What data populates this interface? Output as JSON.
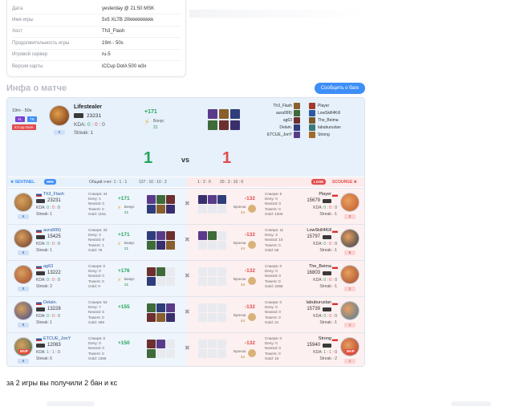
{
  "info": {
    "rows": [
      {
        "key": "Дата",
        "value": "yesterday @ 21:50 MSK"
      },
      {
        "key": "Имя игры",
        "value": "5x5 XLTB 20kkkkkkkkkk"
      },
      {
        "key": "Хост",
        "value": "Th3_Flash"
      },
      {
        "key": "Продолжительность игры",
        "value": "19m - 50s"
      },
      {
        "key": "Игровой сервер",
        "value": "ru-5"
      },
      {
        "key": "Версия карты",
        "value": "iCCup DotA 500 w3x"
      }
    ]
  },
  "section_title": "Инфа о матче",
  "report_button": "Сообщить о баге",
  "banner": {
    "duration": "19m - 50s",
    "tags": [
      "XL",
      "TB"
    ],
    "mode": "iCCup DotA",
    "mvp": {
      "hero": "Lifestealer",
      "mmr": "23231",
      "kda_label": "KDA:",
      "kda": [
        "0",
        "0",
        "0"
      ],
      "streak": "Streak: 1",
      "level": "6"
    },
    "gain": "+171",
    "bonus_label": "Бонус",
    "bonus_value": "21",
    "score_left": "1",
    "vs": "vs",
    "score_right": "1",
    "right_list": [
      "Th3_Flash",
      "aura999)",
      "ag63",
      "Delain.",
      "ETCUE_JonY"
    ],
    "right_list2": [
      "Player",
      "LowSkill4Kill",
      "The_Beima",
      "labuburuslan",
      "Strong"
    ]
  },
  "team_header": {
    "left_label": "SENTINEL",
    "left_result": "WIN",
    "total_label": "Общий счет: 1 : 1 : 1",
    "left_totals": "127 : 10 : 10 : 2",
    "mid_totals": "1 : 2 : 0",
    "right_totals": "20 : 3 : 10 : 0",
    "right_result": "LOSE",
    "right_label": "SCOURGE"
  },
  "rows": [
    {
      "left": {
        "name": "Th3_Flash",
        "mmr": "23231",
        "kda": [
          "0",
          "0",
          "0"
        ],
        "streak": "Streak: 1",
        "level": "6",
        "mvp": false,
        "stats": [
          "Спаерв: 44",
          "Deny: 1",
          "Neutral: 0",
          "Towers: 0",
          "Gold: 1161"
        ],
        "gain": "+171",
        "bonus": "21"
      },
      "right": {
        "name": "Player",
        "mmr": "15679",
        "kda": [
          "0",
          "0",
          "0"
        ],
        "streak": "Streak: -1",
        "level": "3",
        "mvp": false,
        "stats": [
          "Спаерв: 6",
          "Deny: 0",
          "Neutral: 0",
          "Towers: 0",
          "Gold: 1000"
        ],
        "loss": "-132",
        "bronze": "Бронза",
        "bronze_val": "44"
      }
    },
    {
      "left": {
        "name": "aura999)",
        "mmr": "15425",
        "kda": [
          "0",
          "0",
          "0"
        ],
        "streak": "Streak: 1",
        "level": "8",
        "mvp": false,
        "stats": [
          "Спаерв: 33",
          "Deny: 2",
          "Neutral: 8",
          "Towers: 1",
          "Gold: 75"
        ],
        "gain": "+171",
        "bonus": "21"
      },
      "right": {
        "name": "LowSkill4Kill",
        "mmr": "15797",
        "kda": [
          "0",
          "0",
          "0"
        ],
        "streak": "Streak: -1",
        "level": "5",
        "mvp": false,
        "stats": [
          "Спаерв: 11",
          "Deny: 3",
          "Neutral: 10",
          "Towers: 0",
          "Gold: 56"
        ],
        "loss": "-132",
        "bronze": "Бронза",
        "bronze_val": "44"
      }
    },
    {
      "left": {
        "name": "ag63",
        "mmr": "13222",
        "kda": [
          "0",
          "0",
          "0"
        ],
        "streak": "Streak: 2",
        "level": "8",
        "mvp": false,
        "stats": [
          "Спаерв: 0",
          "Deny: 0",
          "Neutral: 0",
          "Towers: 0",
          "Gold: 0"
        ],
        "gain": "+176",
        "bonus": "21"
      },
      "right": {
        "name": "The_Beima",
        "mmr": "16803",
        "kda": [
          "0",
          "0",
          "0"
        ],
        "streak": "Streak: -1",
        "level": "1",
        "mvp": false,
        "stats": [
          "Спаерв: 0",
          "Deny: 0",
          "Neutral: 0",
          "Towers: 0",
          "Gold: 2255"
        ],
        "loss": "-132",
        "bronze": "Бронза",
        "bronze_val": "44"
      }
    },
    {
      "left": {
        "name": "Delain.",
        "mmr": "13228",
        "kda": [
          "0",
          "0",
          "0"
        ],
        "streak": "Streak: 1",
        "level": "8",
        "mvp": false,
        "stats": [
          "Спаерв: 53",
          "Deny: 7",
          "Neutral: 5",
          "Towers: 0",
          "Gold: 469"
        ],
        "gain": "+155",
        "bonus": ""
      },
      "right": {
        "name": "labuburuslan",
        "mmr": "15739",
        "kda": [
          "0",
          "0",
          "0"
        ],
        "streak": "Streak: -1",
        "level": "1",
        "mvp": false,
        "stats": [
          "Спаерв: 0",
          "Deny: 0",
          "Neutral: 0",
          "Towers: 0",
          "Gold: 21"
        ],
        "loss": "-132",
        "bronze": "Бронза",
        "bronze_val": "44"
      }
    },
    {
      "left": {
        "name": "ETCUE_JonY",
        "mmr": "12083",
        "kda": [
          "1",
          "1",
          "0"
        ],
        "streak": "Streak: 6",
        "level": "8",
        "mvp": true,
        "stats": [
          "Спаерв: 0",
          "Deny: 0",
          "Neutral: 0",
          "Towers: 0",
          "Gold: 1365"
        ],
        "gain": "+150",
        "bonus": ""
      },
      "right": {
        "name": "Strong",
        "mmr": "15940",
        "kda": [
          "1",
          "1",
          "0"
        ],
        "streak": "Streak: -2",
        "level": "1",
        "mvp": true,
        "stats": [
          "Спаерв: 0",
          "Deny: 0",
          "Neutral: 0",
          "Towers: 0",
          "Gold: 19"
        ],
        "loss": "-132",
        "bronze": "Бронза",
        "bronze_val": "44"
      }
    }
  ],
  "mvp_label": "MVP",
  "kda_label": "KDA:",
  "footer_text": "за 2 игры вы получили 2 бан и кс",
  "colors": {
    "accent": "#3e8ef7",
    "win": "#23a55a",
    "loss": "#e24b4b",
    "sentinel": "#3e8ef7",
    "scourge": "#e24b4b"
  }
}
